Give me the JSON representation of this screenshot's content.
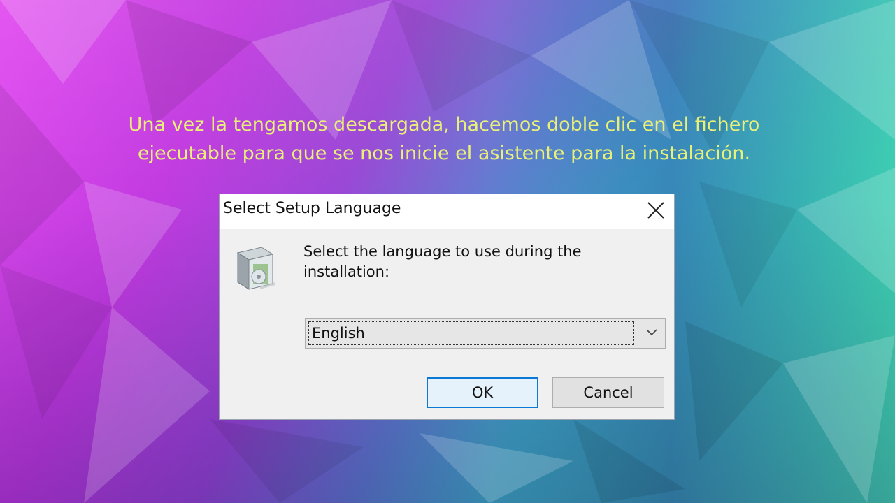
{
  "caption": {
    "line1": "Una vez la tengamos descargada, hacemos doble clic en el fichero",
    "line2": "ejecutable para que se nos inicie el asistente para la instalación."
  },
  "dialog": {
    "title": "Select Setup Language",
    "prompt_line1": "Select the language to use during the",
    "prompt_line2": "installation:",
    "language_select": {
      "selected": "English"
    },
    "ok_label": "OK",
    "cancel_label": "Cancel",
    "icons": {
      "close": "close-icon",
      "setup": "setup-box-icon",
      "dropdown": "chevron-down-icon"
    }
  },
  "colors": {
    "caption_text": "#e8f07a",
    "focus_border": "#0a78d7",
    "dialog_bg": "#f0f0f0"
  }
}
